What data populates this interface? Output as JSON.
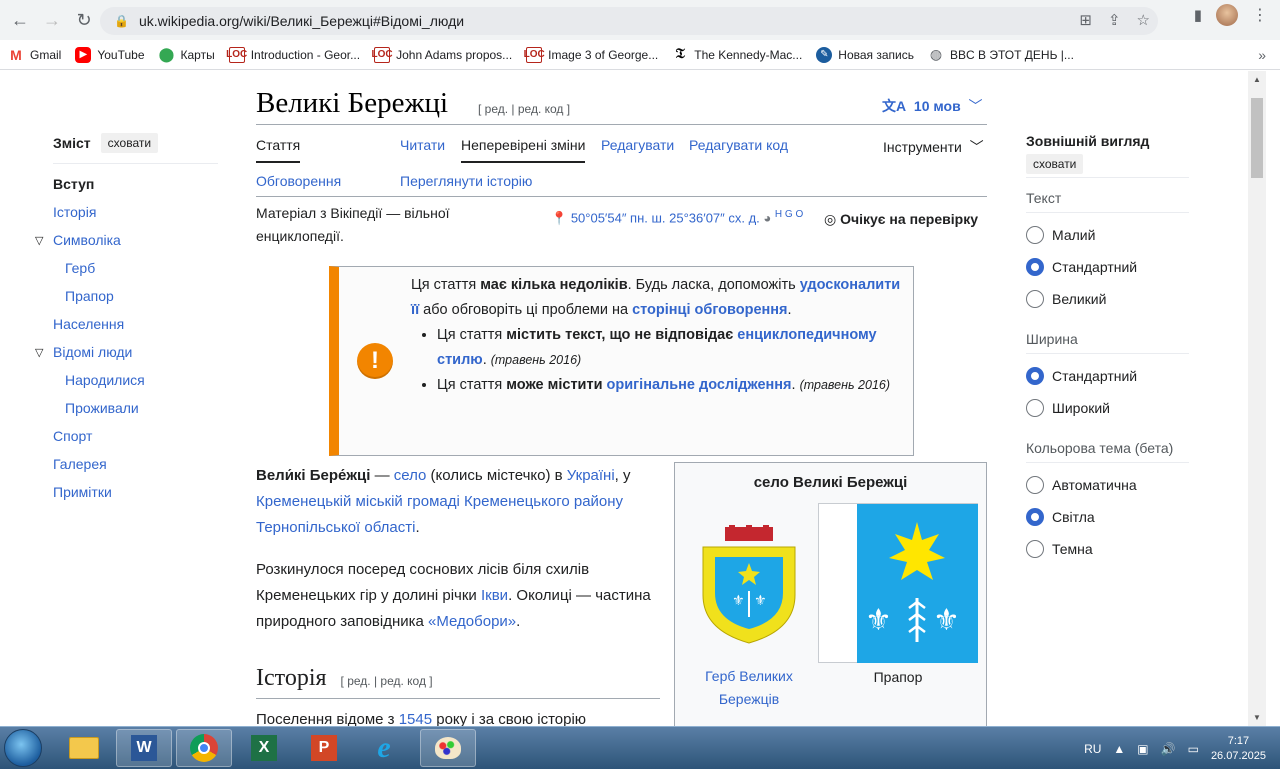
{
  "browser": {
    "url": "uk.wikipedia.org/wiki/Великі_Бережці#Відомі_люди",
    "bookmarks": [
      "Gmail",
      "YouTube",
      "Карты",
      "Introduction - Geor...",
      "John Adams propos...",
      "Image 3 of George...",
      "The Kennedy-Mac...",
      "Новая запись",
      "BBC В ЭТОТ ДЕНЬ |..."
    ]
  },
  "toc": {
    "title": "Зміст",
    "hide": "сховати",
    "items": [
      "Вступ",
      "Історія",
      "Символіка",
      "Герб",
      "Прапор",
      "Населення",
      "Відомі люди",
      "Народилися",
      "Проживали",
      "Спорт",
      "Галерея",
      "Примітки"
    ]
  },
  "article": {
    "title": "Великі Бережці",
    "edit_links": "[ ред. | ред. код ]",
    "languages": "10 мов",
    "tabs": {
      "article": "Стаття",
      "talk": "Обговорення",
      "read": "Читати",
      "pending": "Неперевірені зміни",
      "edit": "Редагувати",
      "edit_source": "Редагувати код",
      "history": "Переглянути історію",
      "tools": "Інструменти"
    },
    "from": "Матеріал з Вікіпедії — вільної енциклопедії.",
    "coords": "50°05′54″ пн. ш. 25°36′07″ сх. д.",
    "coords_extra": "H G O",
    "review": "Очікує на перевірку"
  },
  "ambox": {
    "t1": "Ця стаття ",
    "t2": "має кілька недоліків",
    "t3": ". Будь ласка, допоможіть ",
    "t4": "удосконалити її",
    "t5": " або обговоріть ці проблеми на ",
    "t6": "сторінці обговорення",
    "t7": ".",
    "b1a": "Ця стаття ",
    "b1b": "містить текст, що не відповідає ",
    "b1c": "енциклопедичному стилю",
    "b1d": ". ",
    "b1e": "(травень 2016)",
    "b2a": "Ця стаття ",
    "b2b": "може містити ",
    "b2c": "оригінальне дослідження",
    "b2d": ". ",
    "b2e": "(травень 2016)"
  },
  "lead": {
    "name": "Вели́кі Бере́жці",
    "a": " — ",
    "selo": "село",
    "b": " (колись містечко) в ",
    "ukraine": "Україні",
    "c": ", у ",
    "gromada": "Кременецькій міській громаді Кременецького району Тернопільської області",
    "d": "."
  },
  "para2": {
    "a": "Розкинулося посеред соснових лісів біля схилів Кременецьких гір у долині річки ",
    "ikva": "Ікви",
    "b": ". Околиці — частина природного заповідника ",
    "medobory": "«Медобори»",
    "c": "."
  },
  "history": {
    "heading": "Історія",
    "edit_links": "[ ред. | ред. код ]",
    "a": "Поселення відоме з ",
    "year": "1545",
    "b": " року і за свою історію"
  },
  "infobox": {
    "caption": "село Великі Бережці",
    "coa_caption": "Герб Великих Бережців",
    "flag_caption": "Прапор"
  },
  "appearance": {
    "title": "Зовнішній вигляд",
    "hide": "сховати",
    "text_label": "Текст",
    "text_options": [
      "Малий",
      "Стандартний",
      "Великий"
    ],
    "text_selected": 1,
    "width_label": "Ширина",
    "width_options": [
      "Стандартний",
      "Широкий"
    ],
    "width_selected": 0,
    "theme_label": "Кольорова тема (бета)",
    "theme_options": [
      "Автоматична",
      "Світла",
      "Темна"
    ],
    "theme_selected": 1
  },
  "taskbar": {
    "lang": "RU",
    "time": "7:17",
    "date": "26.07.2025"
  },
  "colors": {
    "link": "#3366cc",
    "ambox_border": "#f28500",
    "flag_blue": "#1ea6e6"
  }
}
